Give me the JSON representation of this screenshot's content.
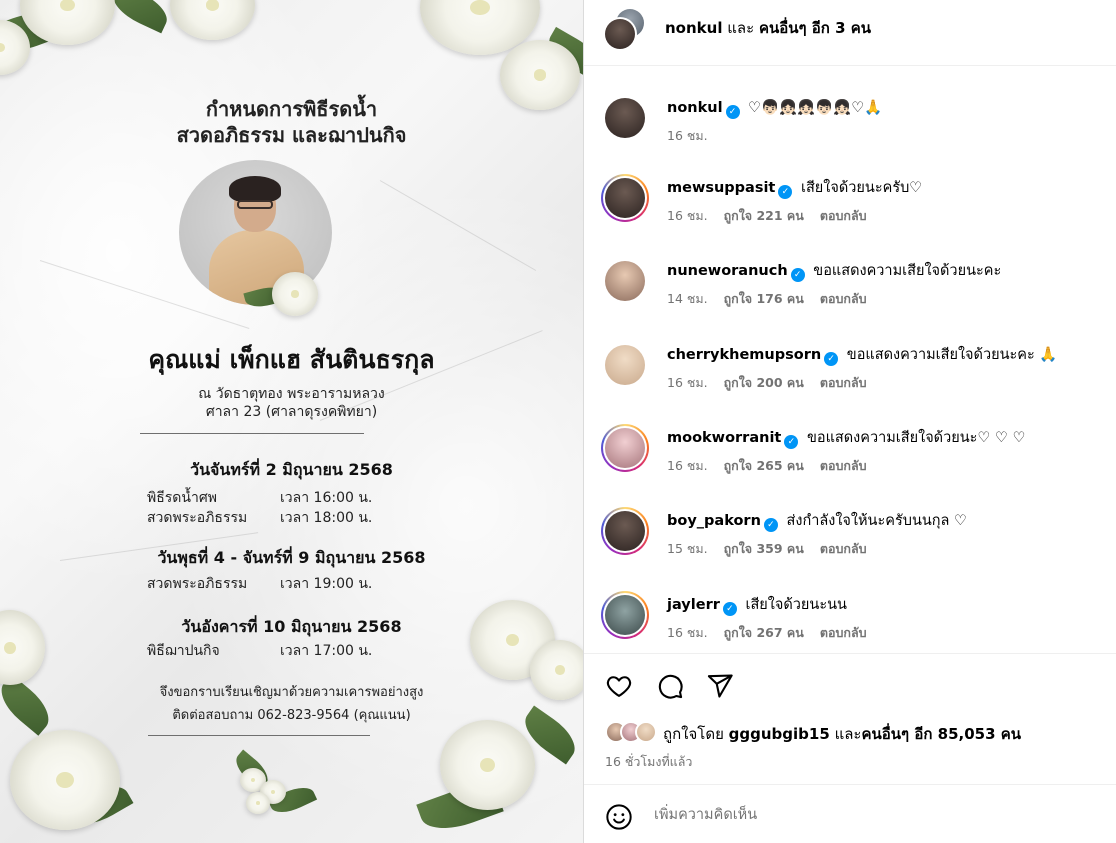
{
  "card": {
    "title_line1": "กำหนดการพิธีรดน้ำ",
    "title_line2": "สวดอภิธรรม และฌาปนกิจ",
    "name": "คุณแม่ เพ็กแฮ สันตินธรกุล",
    "venue_line1": "ณ วัดธาตุทอง พระอารามหลวง",
    "venue_line2": "ศาลา 23 (ศาลาดุรงคพิทยา)",
    "schedule": [
      {
        "date": "วันจันทร์ที่ 2 มิถุนายน 2568",
        "events": [
          {
            "name": "พิธีรดน้ำศพ",
            "time": "เวลา 16:00 น."
          },
          {
            "name": "สวดพระอภิธรรม",
            "time": "เวลา 18:00 น."
          }
        ]
      },
      {
        "date": "วันพุธที่ 4 - จันทร์ที่ 9 มิถุนายน 2568",
        "events": [
          {
            "name": "สวดพระอภิธรรม",
            "time": "เวลา 19:00 น."
          }
        ]
      },
      {
        "date": "วันอังคารที่ 10 มิถุนายน 2568",
        "events": [
          {
            "name": "พิธีฌาปนกิจ",
            "time": "เวลา 17:00 น."
          }
        ]
      }
    ],
    "invite": "จึงขอกราบเรียนเชิญมาด้วยความเคารพอย่างสูง",
    "contact": "ติดต่อสอบถาม 062-823-9564 (คุณแนน)"
  },
  "header": {
    "user": "nonkul",
    "and_text": "และ",
    "others": "คนอื่นๆ อีก 3 คน"
  },
  "caption": {
    "user": "nonkul",
    "text": "♡👦🏻👧🏻👧🏻👦🏻👧🏻♡🙏",
    "time": "16 ชม."
  },
  "comments": [
    {
      "user": "mewsuppasit",
      "text": "เสียใจด้วยนะครับ♡",
      "time": "16 ชม.",
      "likes": "ถูกใจ 221 คน",
      "reply": "ตอบกลับ"
    },
    {
      "user": "nuneworanuch",
      "text": "ขอแสดงความเสียใจด้วยนะคะ",
      "time": "14 ชม.",
      "likes": "ถูกใจ 176 คน",
      "reply": "ตอบกลับ"
    },
    {
      "user": "cherrykhemupsorn",
      "text": "ขอแสดงความเสียใจด้วยนะคะ 🙏",
      "time": "16 ชม.",
      "likes": "ถูกใจ 200 คน",
      "reply": "ตอบกลับ"
    },
    {
      "user": "mookworranit",
      "text": "ขอแสดงความเสียใจด้วยนะ♡ ♡ ♡",
      "time": "16 ชม.",
      "likes": "ถูกใจ 265 คน",
      "reply": "ตอบกลับ"
    },
    {
      "user": "boy_pakorn",
      "text": "ส่งกำลังใจให้นะครับนนกุล ♡",
      "time": "15 ชม.",
      "likes": "ถูกใจ 359 คน",
      "reply": "ตอบกลับ"
    },
    {
      "user": "jaylerr",
      "text": "เสียใจด้วยนะนน",
      "time": "16 ชม.",
      "likes": "ถูกใจ 267 คน",
      "reply": "ตอบกลับ"
    }
  ],
  "actions": {
    "like_icon": "heart-icon",
    "comment_icon": "comment-icon",
    "share_icon": "share-icon"
  },
  "likes": {
    "prefix": "ถูกใจโดย",
    "user": "gggubgib15",
    "and_text": "และ",
    "others": "คนอื่นๆ อีก 85,053 คน"
  },
  "post_time": "16 ชั่วโมงที่แล้ว",
  "add_comment": {
    "placeholder": "เพิ่มความคิดเห็น",
    "emoji_icon": "emoji-icon"
  },
  "colors": {
    "verified": "#0095f6",
    "meta": "#737373",
    "divider": "#efefef"
  }
}
